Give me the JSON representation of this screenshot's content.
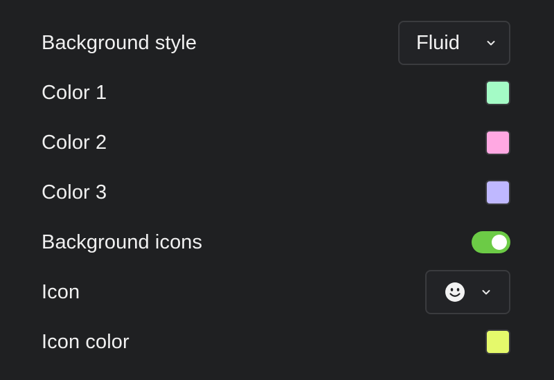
{
  "settings": {
    "background_style": {
      "label": "Background style",
      "value": "Fluid",
      "icon": "chevron-down-icon"
    },
    "color1": {
      "label": "Color 1",
      "color": "#a4fbc6"
    },
    "color2": {
      "label": "Color 2",
      "color": "#ffa8e2"
    },
    "color3": {
      "label": "Color 3",
      "color": "#bfb8ff"
    },
    "background_icons": {
      "label": "Background icons",
      "enabled": true,
      "on_color": "#6ccb46"
    },
    "icon": {
      "label": "Icon",
      "value_icon": "smiley-face-icon",
      "chevron": "chevron-down-icon"
    },
    "icon_color": {
      "label": "Icon color",
      "color": "#e5f96b"
    }
  }
}
